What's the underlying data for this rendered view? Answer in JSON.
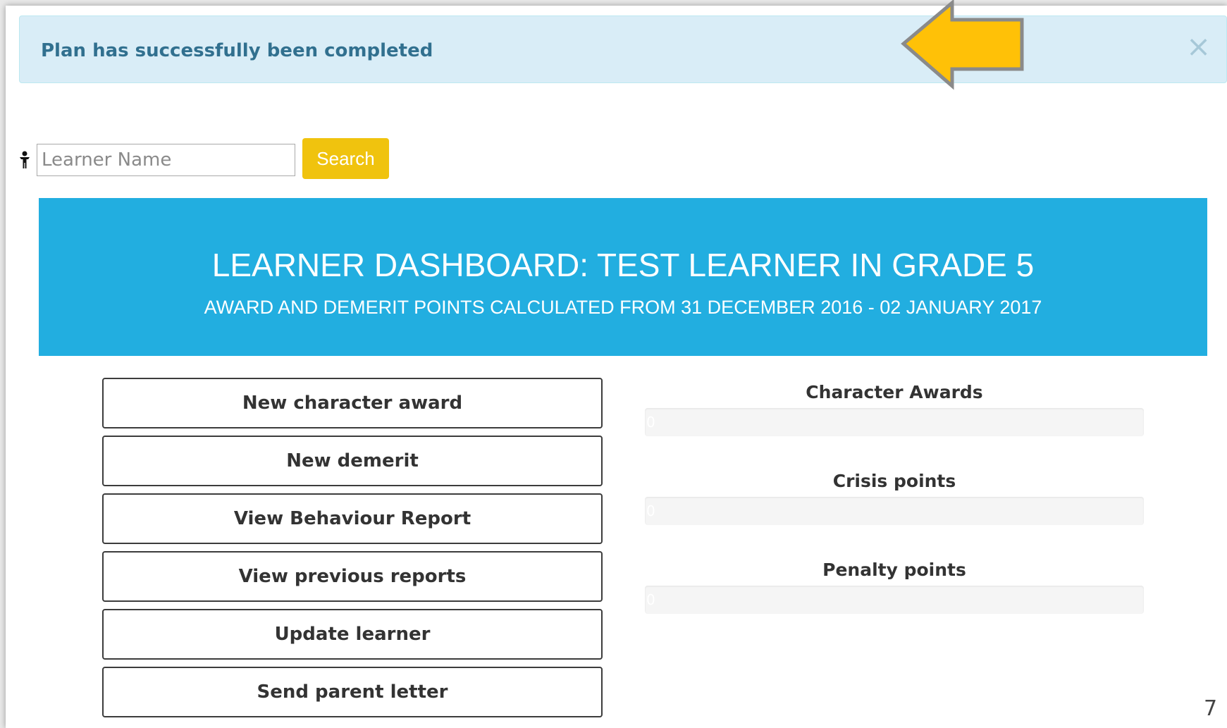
{
  "alert": {
    "message": "Plan has successfully been completed",
    "close_label": "×"
  },
  "annotation": {
    "icon": "arrow-left-icon",
    "color": "#FFC107"
  },
  "search": {
    "icon": "user-icon",
    "placeholder": "Learner Name",
    "value": "",
    "button_label": "Search",
    "button_color": "#F0C30E"
  },
  "banner": {
    "title": "LEARNER DASHBOARD: TEST LEARNER IN GRADE 5",
    "subtitle": "AWARD AND DEMERIT POINTS CALCULATED FROM 31 DECEMBER 2016 - 02 JANUARY 2017",
    "color": "#22AEE0"
  },
  "actions": [
    {
      "label": "New character award"
    },
    {
      "label": "New demerit"
    },
    {
      "label": "View Behaviour Report"
    },
    {
      "label": "View previous reports"
    },
    {
      "label": "Update learner"
    },
    {
      "label": "Send parent letter"
    }
  ],
  "meters": [
    {
      "label": "Character Awards",
      "value": "0",
      "progress": 0
    },
    {
      "label": "Crisis points",
      "value": "0",
      "progress": 0
    },
    {
      "label": "Penalty points",
      "value": "0",
      "progress": 0
    }
  ],
  "slide_number": "7"
}
